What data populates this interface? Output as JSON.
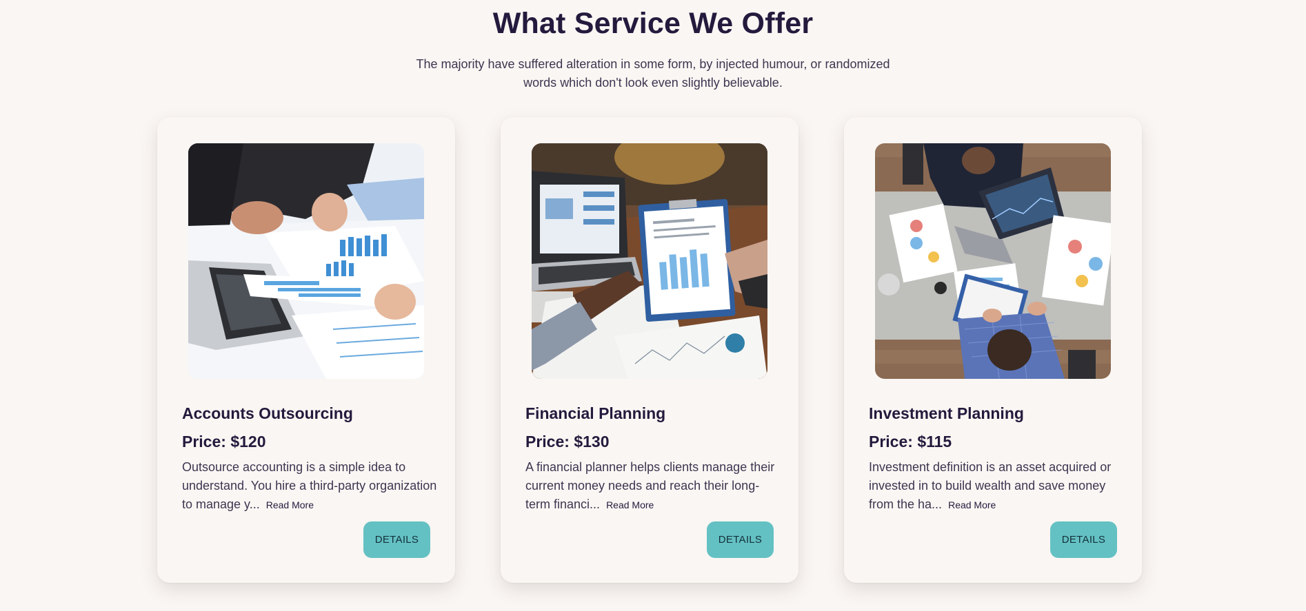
{
  "header": {
    "title": "What Service We Offer",
    "subtitle": "The majority have suffered alteration in some form, by injected humour, or randomized words which don't look even slightly believable."
  },
  "cards": [
    {
      "image": "accounting-documents-photo",
      "title": "Accounts Outsourcing",
      "price": "Price: $120",
      "description": "Outsource accounting is a simple idea to understand. You hire a third-party organization to manage y...",
      "read_more": "Read More",
      "button": "DETAILS"
    },
    {
      "image": "financial-report-clipboard-photo",
      "title": "Financial Planning",
      "price": "Price: $130",
      "description": "A financial planner helps clients manage their current money needs and reach their long-term financi...",
      "read_more": "Read More",
      "button": "DETAILS"
    },
    {
      "image": "business-meeting-overhead-photo",
      "title": "Investment Planning",
      "price": "Price: $115",
      "description": "Investment definition is an asset acquired or invested in to build wealth and save money from the ha...",
      "read_more": "Read More",
      "button": "DETAILS"
    }
  ],
  "colors": {
    "background": "#faf6f3",
    "heading": "#231a3d",
    "body_text": "#3d3550",
    "button": "#64c1c3"
  }
}
